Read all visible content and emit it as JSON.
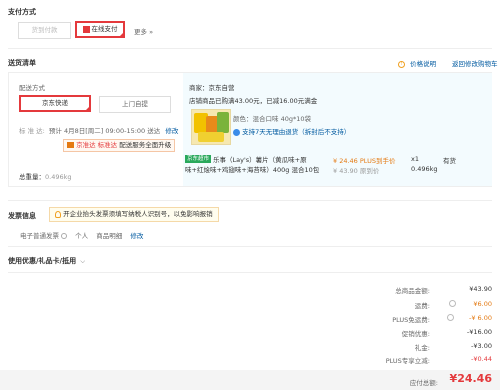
{
  "payment": {
    "title": "支付方式",
    "cod_label": "货到付款",
    "online_label": "在线支付",
    "more_label": "更多 »"
  },
  "delivery": {
    "title": "送货清单",
    "price_note": "价格说明",
    "return_cart": "返回修改购物车",
    "method_title": "配送方式",
    "jd_express": "京东快递",
    "pickup": "上门自提",
    "standard_label": "标 准 达:",
    "standard_value": "预计 4月8日[周二] 09:00-15:00 送达",
    "modify": "修改",
    "tag_jd": "京准达",
    "tag_std": "标准达",
    "tag_upgrade": "配送服务全面升级",
    "weight_label": "总重量：",
    "weight_value": "0.496kg"
  },
  "seller": {
    "name": "商家：京东自营",
    "promo": "店铺商品已购满43.00元，已减16.00元满金"
  },
  "product": {
    "color_label": "颜色：",
    "color_value": "混合口味 40g*10袋",
    "return_note": "支持7天无理由退货（拆封后不支持）",
    "badge": "京东超市",
    "title_line1": "乐事（Lay's）薯片（黄瓜味+原",
    "title_line2": "味+红烩味+鸡翅味+海苔味）400g 混合10包",
    "price": "¥ 24.46 PLUS到手价",
    "orig_price": "¥ 43.90 原到价",
    "qty": "x1",
    "stock": "有货",
    "weight": "0.496kg"
  },
  "invoice": {
    "title": "发票信息",
    "tip": "开企业抬头发票须填写纳税人识别号，以免影响报销",
    "type": "电子普通发票",
    "owner": "个人",
    "content": "商品明细",
    "modify": "修改"
  },
  "coupon": {
    "title": "使用优惠/礼品卡/抵用"
  },
  "summary": {
    "rows": [
      {
        "label": "总商品金额:",
        "value": "¥43.90"
      },
      {
        "label": "运费:",
        "value": "¥6.00"
      },
      {
        "label": "PLUS免运费:",
        "value": "-¥ 6.00"
      },
      {
        "label": "促销优惠:",
        "value": "-¥16.00"
      },
      {
        "label": "礼金:",
        "value": "-¥3.00"
      },
      {
        "label": "PLUS专享立减:",
        "value": "-¥0.44"
      }
    ],
    "total_label": "应付总额:",
    "total_value": "¥24.46"
  },
  "colors": {
    "accent": "#e4393c",
    "link": "#005aa0",
    "highlight_bg": "#f3fbfe"
  }
}
